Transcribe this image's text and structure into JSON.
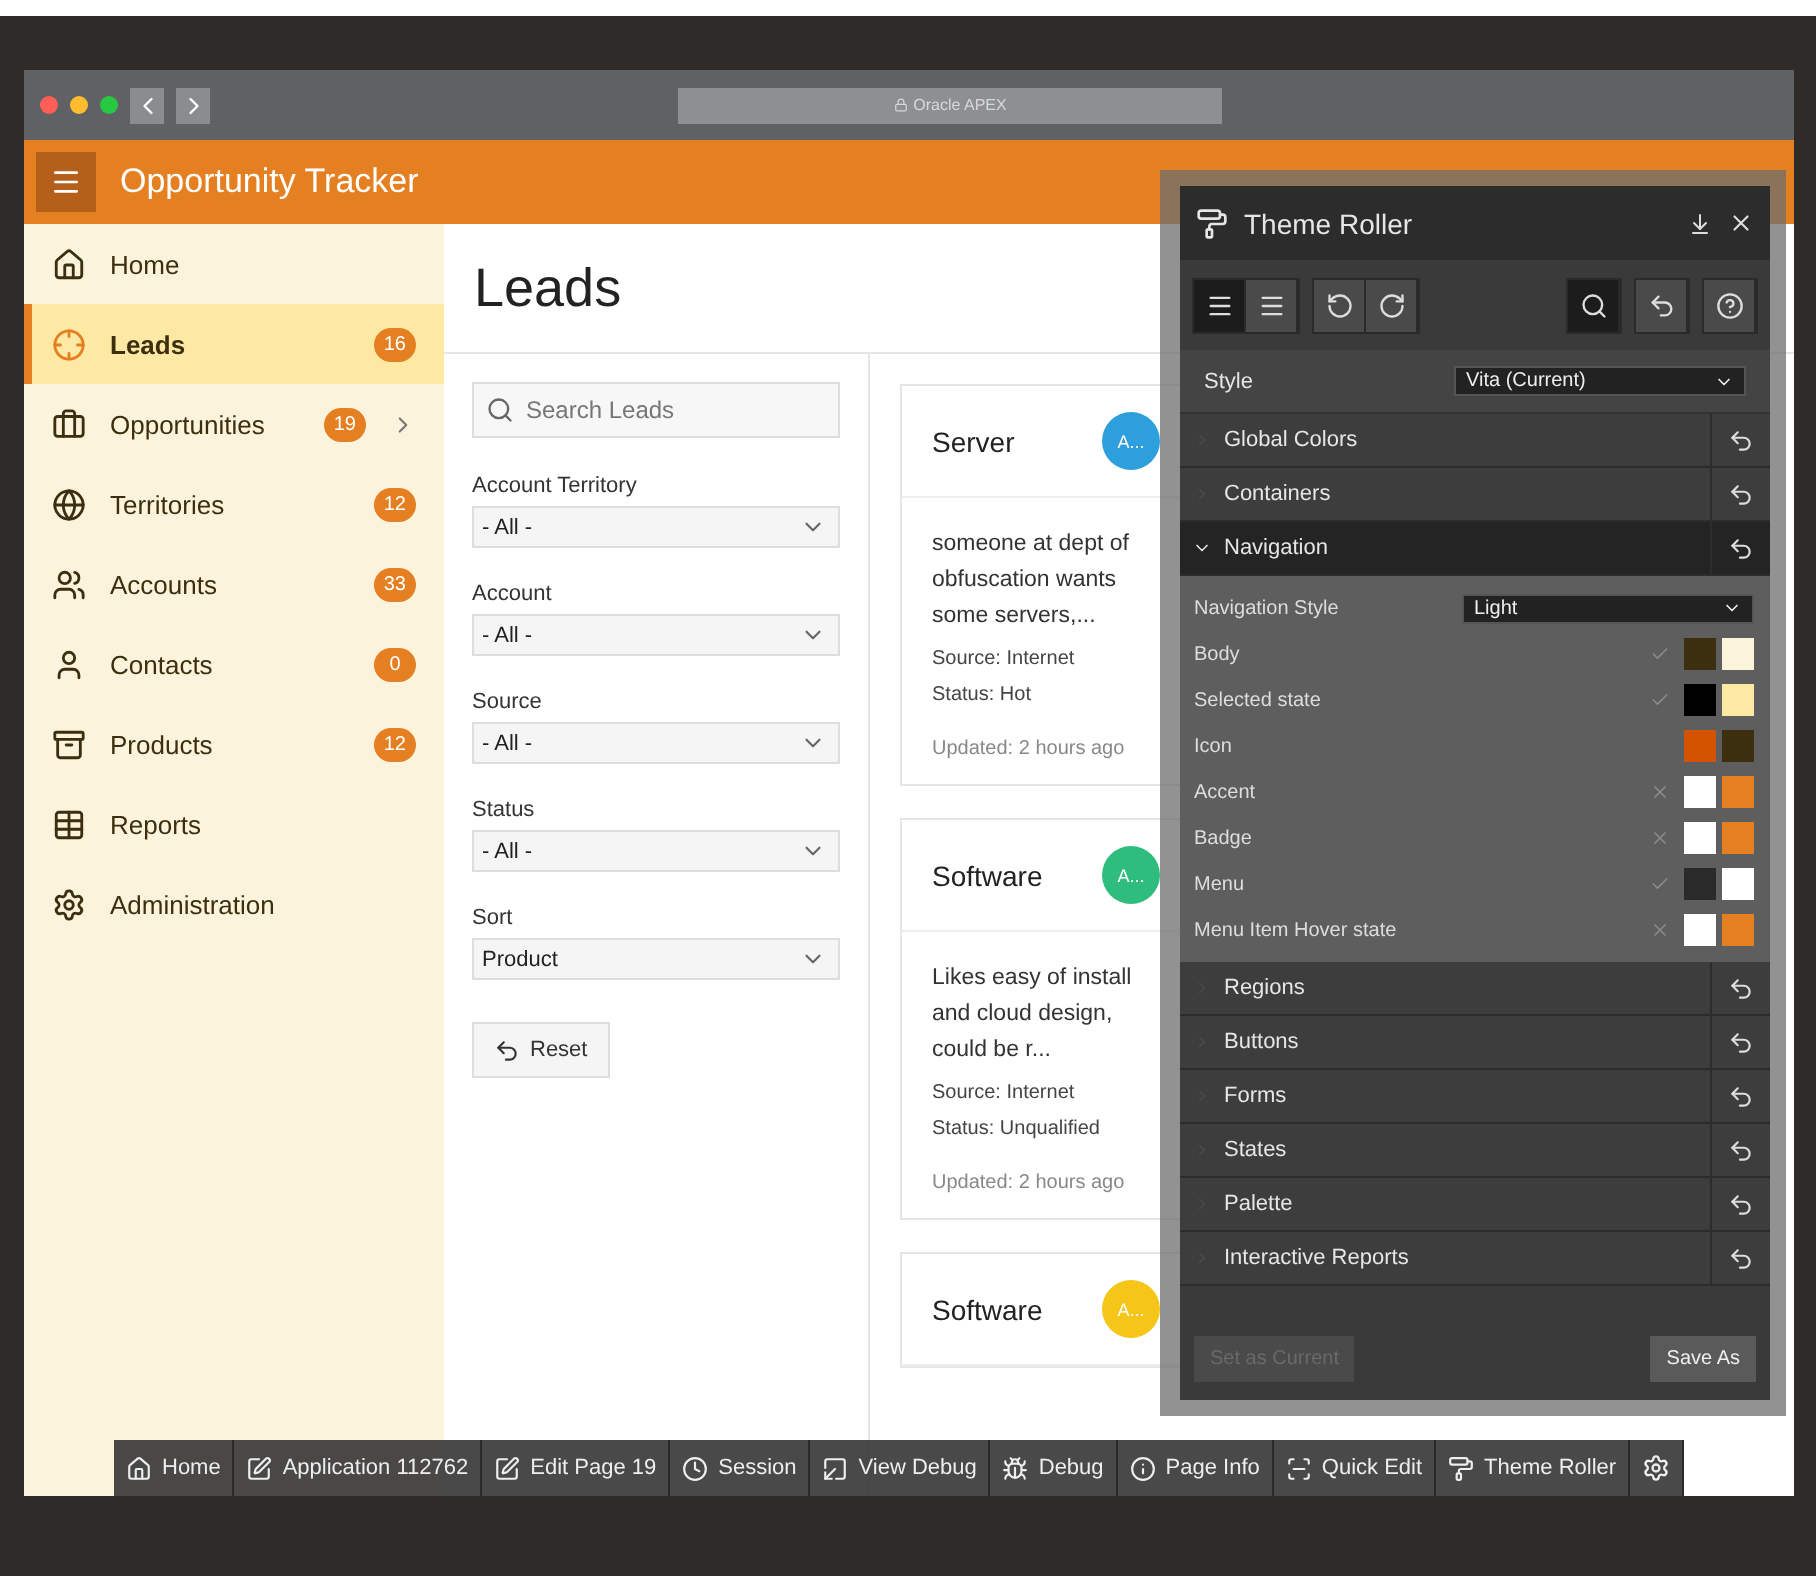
{
  "browser": {
    "address": "Oracle APEX"
  },
  "app": {
    "title": "Opportunity Tracker"
  },
  "sidebar": {
    "items": [
      {
        "label": "Home",
        "selected": false,
        "expandable": false
      },
      {
        "label": "Leads",
        "badge": "16",
        "selected": true,
        "expandable": false
      },
      {
        "label": "Opportunities",
        "badge": "19",
        "selected": false,
        "expandable": true
      },
      {
        "label": "Territories",
        "badge": "12",
        "selected": false,
        "expandable": false
      },
      {
        "label": "Accounts",
        "badge": "33",
        "selected": false,
        "expandable": false
      },
      {
        "label": "Contacts",
        "badge": "0",
        "selected": false,
        "expandable": false
      },
      {
        "label": "Products",
        "badge": "12",
        "selected": false,
        "expandable": false
      },
      {
        "label": "Reports",
        "selected": false,
        "expandable": false
      },
      {
        "label": "Administration",
        "selected": false,
        "expandable": false
      }
    ]
  },
  "page": {
    "title": "Leads"
  },
  "filters": {
    "search": {
      "placeholder": "Search Leads"
    },
    "selects": [
      {
        "label": "Account Territory",
        "value": "- All -"
      },
      {
        "label": "Account",
        "value": "- All -"
      },
      {
        "label": "Source",
        "value": "- All -"
      },
      {
        "label": "Status",
        "value": "- All -"
      },
      {
        "label": "Sort",
        "value": "Product"
      }
    ],
    "reset": "Reset"
  },
  "cards": [
    {
      "title": "Server",
      "avatar": "A...",
      "color": "#2d9fdc",
      "description": "someone at dept of obfuscation wants some servers,...",
      "source": "Source: Internet",
      "status": "Status: Hot",
      "updated": "Updated: 2 hours ago"
    },
    {
      "title": "Software",
      "avatar": "A...",
      "color": "#2ebd7c",
      "description": "Likes easy of install and cloud design, could be r...",
      "source": "Source: Internet",
      "status": "Status: Unqualified",
      "updated": "Updated: 2 hours ago"
    },
    {
      "title": "Software",
      "avatar": "A...",
      "color": "#f5c518"
    }
  ],
  "theme_roller": {
    "title": "Theme Roller",
    "view_modes": [
      {
        "selected": true
      },
      {
        "selected": false
      }
    ],
    "style": {
      "label": "Style",
      "value": "Vita (Current)"
    },
    "sections": [
      {
        "label": "Global Colors",
        "expanded": false
      },
      {
        "label": "Containers",
        "expanded": false
      },
      {
        "label": "Navigation",
        "expanded": true,
        "select": {
          "label": "Navigation Style",
          "value": "Light"
        },
        "rows": [
          {
            "label": "Body",
            "kind": "pass",
            "swatches": [
              {
                "color": "#3b2f0f"
              },
              {
                "color": "#fbf3dc"
              }
            ]
          },
          {
            "label": "Selected state",
            "kind": "pass",
            "swatches": [
              {
                "color": "#000000"
              },
              {
                "color": "#fde8a4"
              }
            ]
          },
          {
            "label": "Icon",
            "kind": "plain",
            "swatches": [
              {
                "color": "#d35400"
              },
              {
                "color": "#3b2f0f"
              }
            ]
          },
          {
            "label": "Accent",
            "kind": "fail",
            "swatches": [
              {
                "color": "#ffffff"
              },
              {
                "color": "#e67e22"
              }
            ]
          },
          {
            "label": "Badge",
            "kind": "fail",
            "swatches": [
              {
                "color": "#ffffff"
              },
              {
                "color": "#e67e22"
              }
            ]
          },
          {
            "label": "Menu",
            "kind": "pass",
            "swatches": [
              {
                "color": "#2a2a2a"
              },
              {
                "color": "#ffffff"
              }
            ]
          },
          {
            "label": "Menu Item Hover state",
            "kind": "fail",
            "swatches": [
              {
                "color": "#ffffff"
              },
              {
                "color": "#e67e22"
              }
            ]
          }
        ]
      },
      {
        "label": "Regions",
        "expanded": false
      },
      {
        "label": "Buttons",
        "expanded": false
      },
      {
        "label": "Forms",
        "expanded": false
      },
      {
        "label": "States",
        "expanded": false
      },
      {
        "label": "Palette",
        "expanded": false
      },
      {
        "label": "Interactive Reports",
        "expanded": false
      }
    ],
    "buttons": [
      {
        "label": "Set as Current",
        "disabled": true
      },
      {
        "label": "Save As",
        "disabled": false
      }
    ]
  },
  "dev_toolbar": {
    "items": [
      {
        "label": "Home"
      },
      {
        "label": "Application 112762"
      },
      {
        "label": "Edit Page 19"
      },
      {
        "label": "Session"
      },
      {
        "label": "View Debug"
      },
      {
        "label": "Debug"
      },
      {
        "label": "Page Info"
      },
      {
        "label": "Quick Edit"
      },
      {
        "label": "Theme Roller"
      }
    ]
  }
}
